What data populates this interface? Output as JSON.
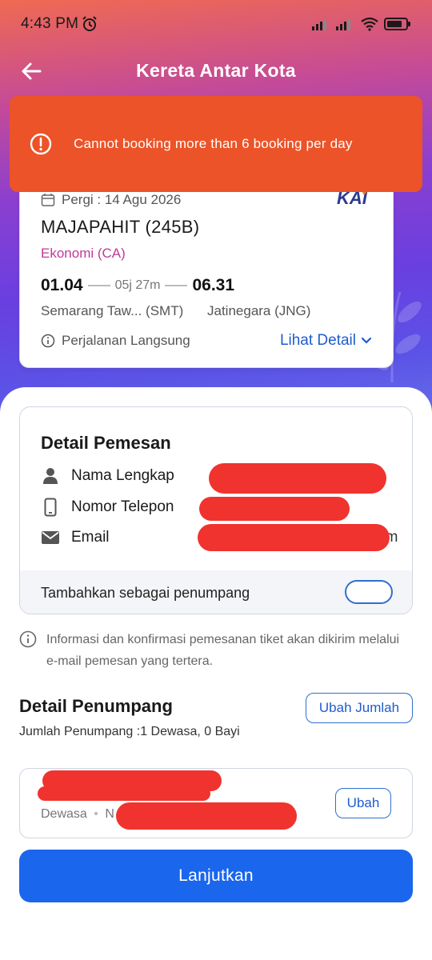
{
  "status_bar": {
    "time": "4:43 PM",
    "icons": [
      "alarm-icon",
      "signal-icon",
      "signal-icon",
      "wifi-icon",
      "battery-icon"
    ]
  },
  "header": {
    "title": "Kereta Antar Kota",
    "back_icon": "arrow-left-icon"
  },
  "toast": {
    "message": "Cannot booking more than 6 booking per day",
    "color": "#ec5328"
  },
  "trip": {
    "date": "Pergi : 14 Agu 2026",
    "logo_text": "KAI",
    "train_name": "MAJAPAHIT (245B)",
    "train_class": "Ekonomi (CA)",
    "depart_time": "01.04",
    "duration": "05j 27m",
    "arrive_time": "06.31",
    "origin": "Semarang Taw... (SMT)",
    "destination": "Jatinegara  (JNG)",
    "route_type": "Perjalanan Langsung",
    "detail_link": "Lihat Detail"
  },
  "pemesan": {
    "heading": "Detail Pemesan",
    "name_label": "Nama Lengkap",
    "name_value": ": ",
    "phone_label": "Nomor Telepon",
    "email_label": "Email",
    "email_tail": "om",
    "add_passenger_label": "Tambahkan sebagai penumpang"
  },
  "email_note": "Informasi dan konfirmasi pemesanan tiket akan dikirim melalui e-mail pemesan yang tertera.",
  "penumpang": {
    "heading": "Detail Penumpang",
    "edit_count_label": "Ubah Jumlah",
    "count_text": "Jumlah Penumpang :1 Dewasa, 0 Bayi",
    "passenger_type": "Dewasa",
    "passenger_type_sep": "•",
    "passenger_id_prefix": "N",
    "edit_label": "Ubah"
  },
  "cta_label": "Lanjutkan",
  "colors": {
    "accent_blue": "#1a66ec",
    "link_blue": "#1f5ccf",
    "class_pink": "#c2399a",
    "redaction_red": "#f0332e"
  }
}
